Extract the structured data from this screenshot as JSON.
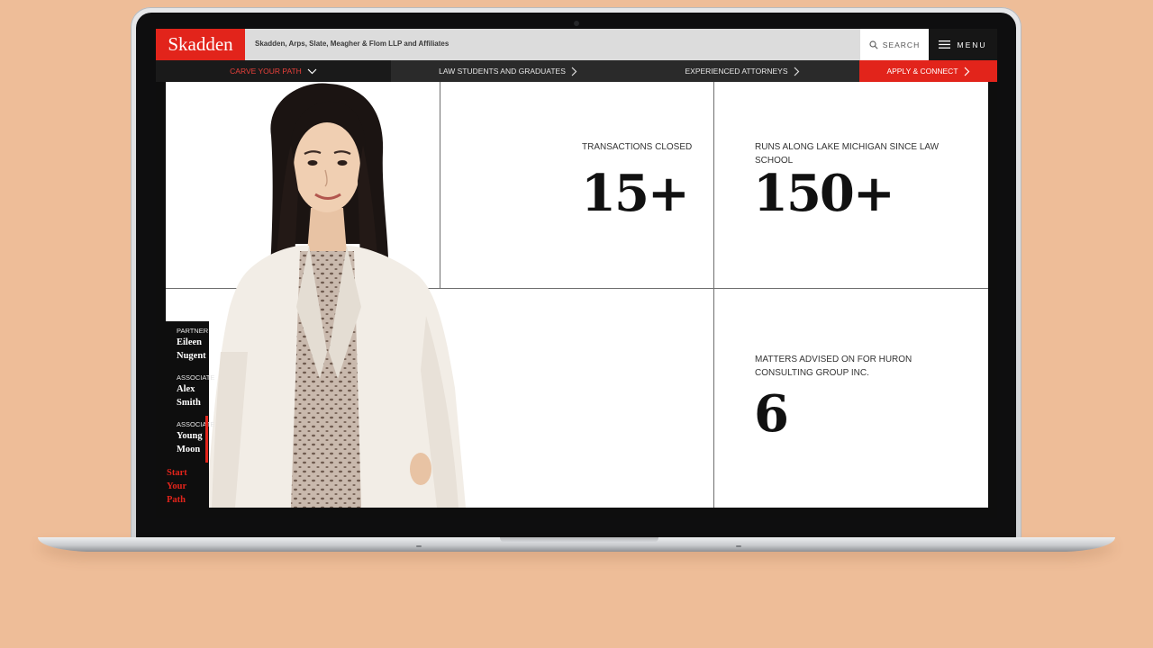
{
  "brand": {
    "logo": "Skadden",
    "firm_name": "Skadden, Arps, Slate, Meagher & Flom LLP and Affiliates",
    "accent": "#e2241b"
  },
  "header": {
    "search_label": "SEARCH",
    "search_icon": "search-icon",
    "menu_label": "MENU",
    "menu_icon": "hamburger-icon"
  },
  "nav": {
    "items": [
      {
        "label": "CARVE YOUR PATH",
        "icon": "chevron-down-icon",
        "active": true
      },
      {
        "label": "LAW STUDENTS AND GRADUATES",
        "icon": "chevron-right-icon"
      },
      {
        "label": "EXPERIENCED ATTORNEYS",
        "icon": "chevron-right-icon"
      },
      {
        "label": "APPLY & CONNECT",
        "icon": "chevron-right-icon"
      }
    ]
  },
  "stats": [
    {
      "label": "TRANSACTIONS CLOSED",
      "value": "15+"
    },
    {
      "label": "RUNS ALONG LAKE MICHIGAN SINCE LAW SCHOOL",
      "value": "150+"
    },
    {
      "label": "MATTERS ADVISED ON FOR HURON CONSULTING GROUP INC.",
      "value": "6"
    }
  ],
  "people": [
    {
      "role": "PARTNER",
      "name": "Eileen Nugent"
    },
    {
      "role": "ASSOCIATE",
      "name": "Alex Smith"
    },
    {
      "role": "ASSOCIATE",
      "name": "Young Moon",
      "selected": true
    }
  ],
  "cta_label": "Start Your Path"
}
